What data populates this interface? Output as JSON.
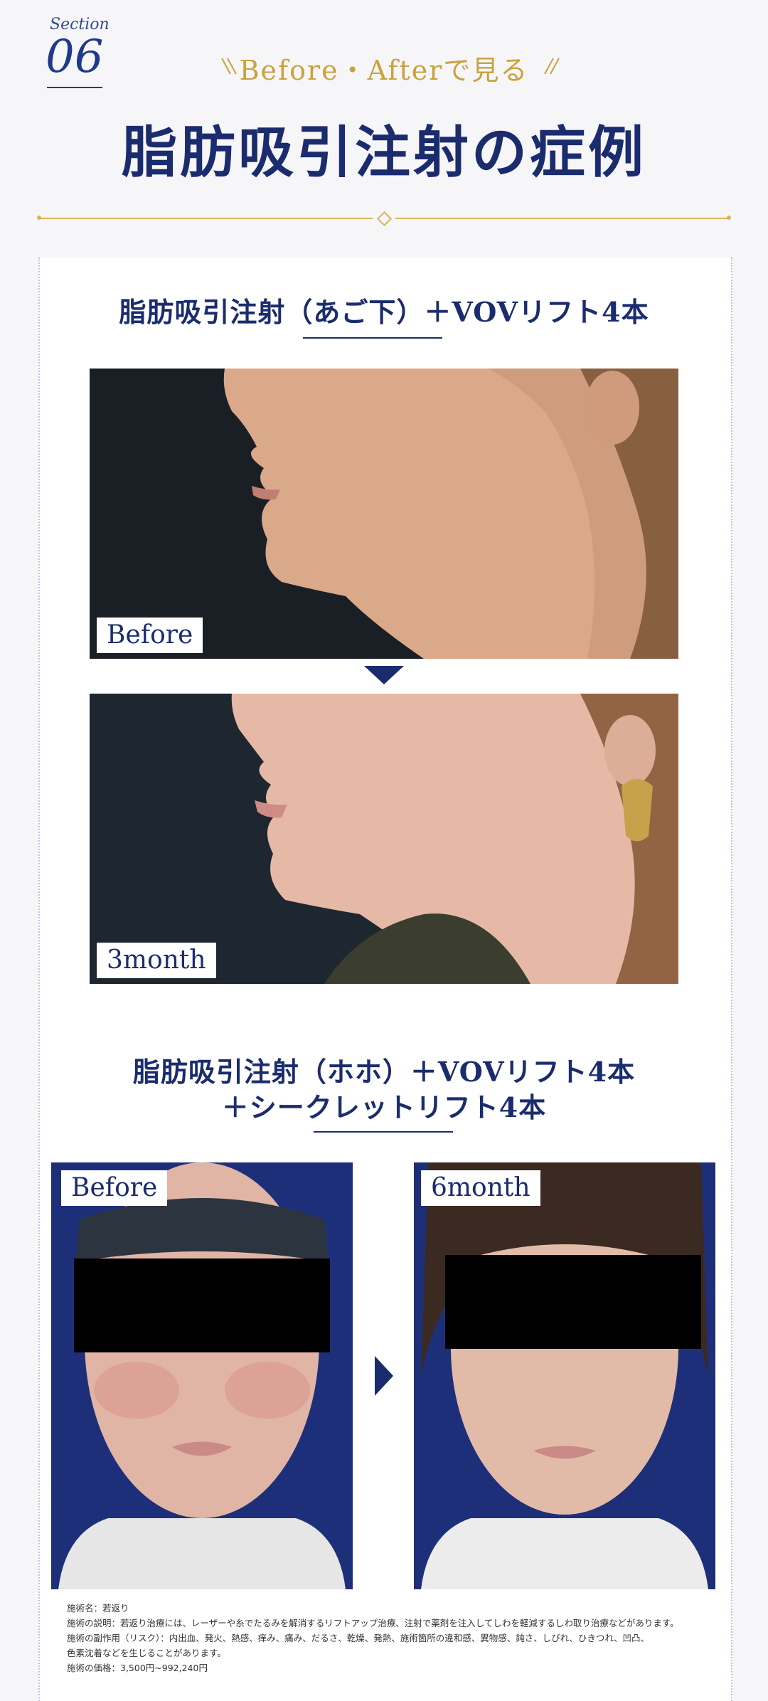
{
  "section": {
    "label": "Section",
    "number": "06"
  },
  "eyebrow": "Before・Afterで見る",
  "title": "脂肪吸引注射の症例",
  "case1": {
    "title": "脂肪吸引注射（あご下）＋VOVリフト4本",
    "before_label": "Before",
    "after_label": "3month"
  },
  "case2": {
    "title_line1": "脂肪吸引注射（ホホ）＋VOVリフト4本",
    "title_line2": "＋シークレットリフト4本",
    "before_label": "Before",
    "after_label": "6month"
  },
  "notes": {
    "line1": "施術名：若返り",
    "line2": "施術の説明：若返り治療には、レーザーや糸でたるみを解消するリフトアップ治療、注射で薬剤を注入してしわを軽減するしわ取り治療などがあります。",
    "line3": "施術の副作用（リスク）：内出血、発火、熱感、痒み、痛み、だるさ、乾燥、発熱、施術箇所の違和感、異物感、鈍さ、しびれ、ひきつれ、凹凸、",
    "line4": "色素沈着などを生じることがあります。",
    "line5": "施術の価格：3,500円~992,240円"
  },
  "colors": {
    "navy": "#1b2c6e",
    "gold": "#c9a23c",
    "accent_blue": "#1f3a8a"
  },
  "icons": {
    "eyebrow_decoration": "double-slash-icon",
    "arrow_down": "triangle-down-icon",
    "arrow_right": "triangle-right-icon"
  }
}
